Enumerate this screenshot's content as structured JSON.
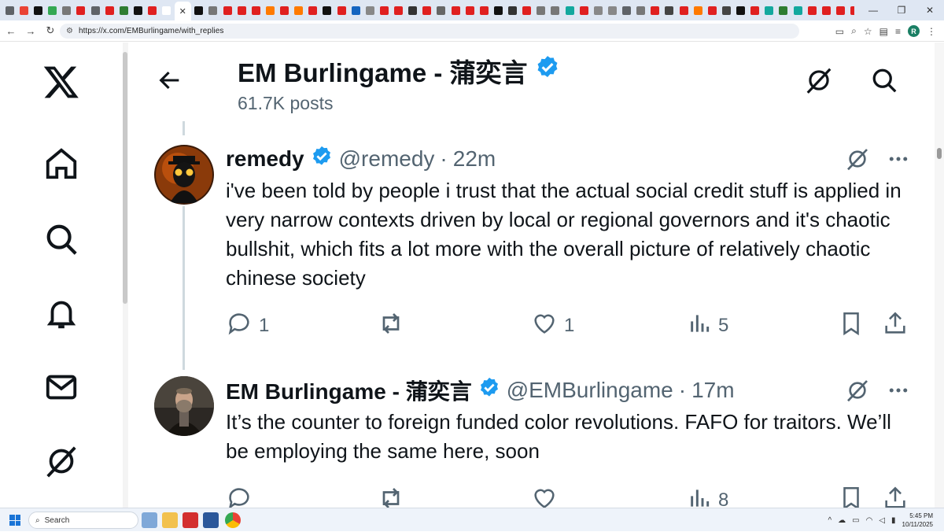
{
  "browser": {
    "tab_favicon_colors": [
      "#5f6368",
      "#ea4335",
      "#111111",
      "#34a853",
      "#777777",
      "#e02020",
      "#5f6368",
      "#e02020",
      "#2e7d32",
      "#111111",
      "#e02020",
      "#ffffff",
      "#111111",
      "#777777",
      "#e02020",
      "#e02020",
      "#e02020",
      "#ff7a00",
      "#e02020",
      "#ff7a00",
      "#e02020",
      "#111111",
      "#e02020",
      "#1565c0",
      "#888888",
      "#e02020",
      "#e02020",
      "#333333",
      "#e02020",
      "#666666",
      "#e02020",
      "#e02020",
      "#e02020",
      "#111111",
      "#333333",
      "#e02020",
      "#777777",
      "#777777",
      "#13a89e",
      "#e02020",
      "#888888",
      "#888888",
      "#5f6368",
      "#777777",
      "#e02020",
      "#444444",
      "#e02020",
      "#ff7a00",
      "#e02020",
      "#444444",
      "#111111",
      "#e02020",
      "#13a89e",
      "#2e7d32",
      "#13a89e",
      "#e02020",
      "#e02020",
      "#e02020",
      "#e02020",
      "#555555",
      "#e02020",
      "#13a89e",
      "#ff7a00",
      "#555555"
    ],
    "active_tab_icon": "close-icon",
    "active_tab_close": "✕",
    "new_tab_label": "+",
    "window_controls": [
      "—",
      "❐",
      "✕"
    ],
    "url": "https://x.com/EMBurlingame/with_replies",
    "profile_initial": "R"
  },
  "header": {
    "title": "EM Burlingame - 蒲奕言",
    "posts_count": "61.7K posts",
    "verified_color": "#1d9bf0"
  },
  "sidebar": {
    "items": [
      {
        "icon": "x-logo-icon"
      },
      {
        "icon": "home-icon"
      },
      {
        "icon": "search-icon"
      },
      {
        "icon": "bell-icon"
      },
      {
        "icon": "mail-icon"
      },
      {
        "icon": "grok-icon"
      }
    ]
  },
  "tweets": [
    {
      "name": "remedy",
      "handle": "@remedy",
      "separator": "·",
      "time": "22m",
      "text": "i've been told by people i trust that the actual social credit stuff is applied in very narrow contexts driven by local or regional governors and it's chaotic bullshit, which fits a lot more with the overall picture of relatively chaotic chinese society",
      "replies": "1",
      "retweets": "",
      "likes": "1",
      "views": "5"
    },
    {
      "name": "EM Burlingame - 蒲奕言",
      "handle": "@EMBurlingame",
      "separator": "·",
      "time": "17m",
      "text": "It’s the counter to foreign funded color revolutions. FAFO for traitors. We’ll be employing the same here, soon",
      "replies": "",
      "retweets": "",
      "likes": "",
      "views": "8"
    }
  ],
  "taskbar": {
    "search_placeholder": "Search",
    "time": "5:45 PM",
    "date": "10/11/2025",
    "tray_chevron": "^"
  }
}
